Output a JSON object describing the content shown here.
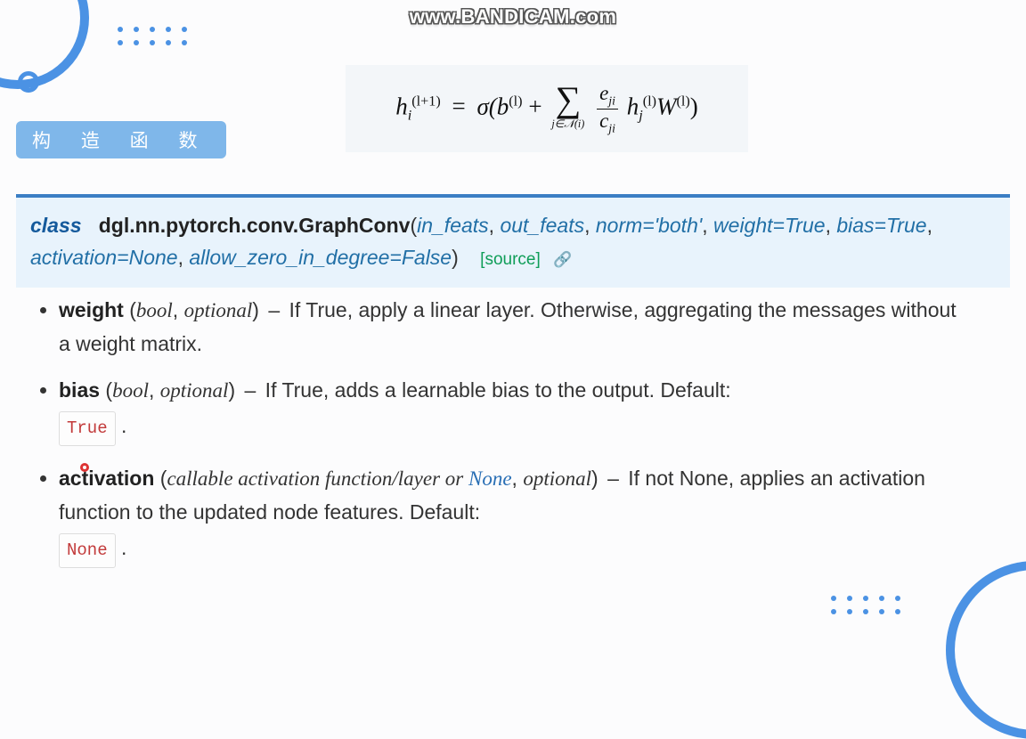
{
  "watermark": "www.BANDICAM.com",
  "heading": "构 造 函 数",
  "formula": {
    "lhs_var": "h",
    "lhs_sub": "i",
    "lhs_sup": "(l+1)",
    "eq": "=",
    "sigma": "σ(",
    "b": "b",
    "b_sup": "(l)",
    "plus": " + ",
    "sum_sub": "j∈𝒩(i)",
    "frac_num_e": "e",
    "frac_num_sub": "ji",
    "frac_den_c": "c",
    "frac_den_sub": "ji",
    "h2": "h",
    "h2_sub": "j",
    "h2_sup": "(l)",
    "W": "W",
    "W_sup": "(l)",
    "close": ")"
  },
  "signature": {
    "kw": "class",
    "module": "dgl.nn.pytorch.conv.GraphConv",
    "open": "(",
    "p1": "in_feats",
    "c1": ", ",
    "p2": "out_feats",
    "c2": ", ",
    "p3": "norm='both'",
    "c3": ", ",
    "p4": "weight=True",
    "c4": ", ",
    "p5": "bias=True",
    "c5": ", ",
    "p6": "activation=None",
    "c6": ", ",
    "p7": "allow_zero_in_degree=False",
    "close": ")",
    "source": "[source]"
  },
  "params": {
    "weight": {
      "name": "weight",
      "open": " (",
      "type": "bool",
      "comma": ", ",
      "opt": "optional",
      "close": ") ",
      "dash": "–",
      "desc": " If True, apply a linear layer. Otherwise, aggregating the messages without a weight matrix."
    },
    "bias": {
      "name": "bias",
      "open": " (",
      "type": "bool",
      "comma": ", ",
      "opt": "optional",
      "close": ") ",
      "dash": "–",
      "desc": " If True, adds a learnable bias to the output. Default: ",
      "default": "True",
      "period": " ."
    },
    "activation": {
      "name": "activation",
      "open": " (",
      "type1": "callable activation function/layer or ",
      "type_none": "None",
      "comma": ", ",
      "opt": "optional",
      "close": ") ",
      "dash": "–",
      "desc": " If not None, applies an activation function to the updated node features. Default: ",
      "default": "None",
      "period": " ."
    }
  }
}
